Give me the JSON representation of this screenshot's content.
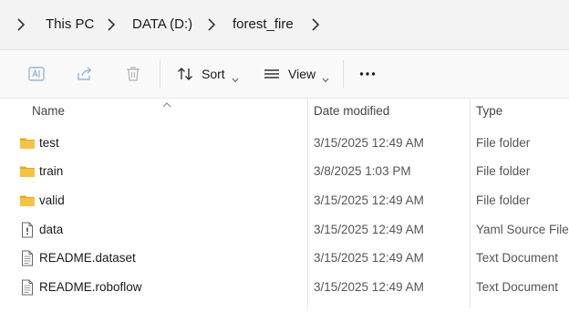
{
  "breadcrumb": {
    "items": [
      "This PC",
      "DATA (D:)",
      "forest_fire"
    ]
  },
  "toolbar": {
    "sort_label": "Sort",
    "view_label": "View",
    "icons": [
      "rename-icon",
      "share-icon",
      "delete-icon",
      "sort-icon",
      "view-icon",
      "more-icon"
    ]
  },
  "columns": {
    "name": "Name",
    "date_modified": "Date modified",
    "type": "Type"
  },
  "files": [
    {
      "name": "test",
      "date": "3/15/2025 12:49 AM",
      "type": "File folder",
      "icon": "folder-icon"
    },
    {
      "name": "train",
      "date": "3/8/2025 1:03 PM",
      "type": "File folder",
      "icon": "folder-icon"
    },
    {
      "name": "valid",
      "date": "3/15/2025 12:49 AM",
      "type": "File folder",
      "icon": "folder-icon"
    },
    {
      "name": "data",
      "date": "3/15/2025 12:49 AM",
      "type": "Yaml Source File",
      "icon": "yaml-file-icon"
    },
    {
      "name": "README.dataset",
      "date": "3/15/2025 12:49 AM",
      "type": "Text Document",
      "icon": "text-file-icon"
    },
    {
      "name": "README.roboflow",
      "date": "3/15/2025 12:49 AM",
      "type": "Text Document",
      "icon": "text-file-icon"
    }
  ],
  "colors": {
    "folder": "#f5c342",
    "folder_dark": "#e8a917",
    "toolbar_bg": "#f9f9f9",
    "address_bg": "#f3f3f3",
    "disabled_icon": "#9ab8d6"
  }
}
